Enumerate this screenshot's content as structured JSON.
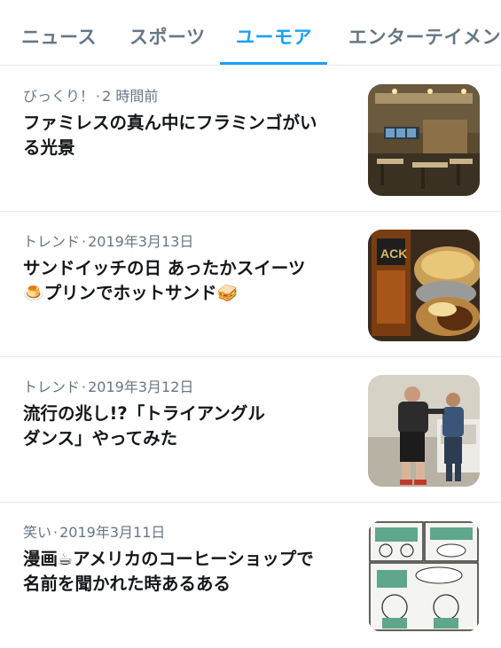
{
  "tabs": [
    {
      "label": "ニュース",
      "active": false
    },
    {
      "label": "スポーツ",
      "active": false
    },
    {
      "label": "ユーモア",
      "active": true
    },
    {
      "label": "エンターテイメン",
      "active": false
    }
  ],
  "accent_color": "#1da1f2",
  "items": [
    {
      "category": "びっくり！",
      "time": "2 時間前",
      "headline_1": "ファミレスの真ん中にフラミンゴがい",
      "headline_2": "る光景",
      "thumbnail": "restaurant-interior-photo"
    },
    {
      "category": "トレンド",
      "time": "2019年3月13日",
      "headline_1": "サンドイッチの日 あったかスイーツ",
      "headline_2_emoji": "🍮",
      "headline_2": "プリンでホットサンド",
      "headline_2_emoji_end": "🥪",
      "thumbnail": "hot-sandwich-photo"
    },
    {
      "category": "トレンド",
      "time": "2019年3月12日",
      "headline_1": "流行の兆し!?「トライアングル",
      "headline_2": "ダンス」やってみた",
      "thumbnail": "dancing-men-photo"
    },
    {
      "category": "笑い",
      "time": "2019年3月11日",
      "headline_1_a": "漫画",
      "headline_1_emoji": "☕",
      "headline_1_b": "アメリカのコーヒーショップで",
      "headline_2": "名前を聞かれた時あるある",
      "thumbnail": "manga-comic-image"
    }
  ]
}
